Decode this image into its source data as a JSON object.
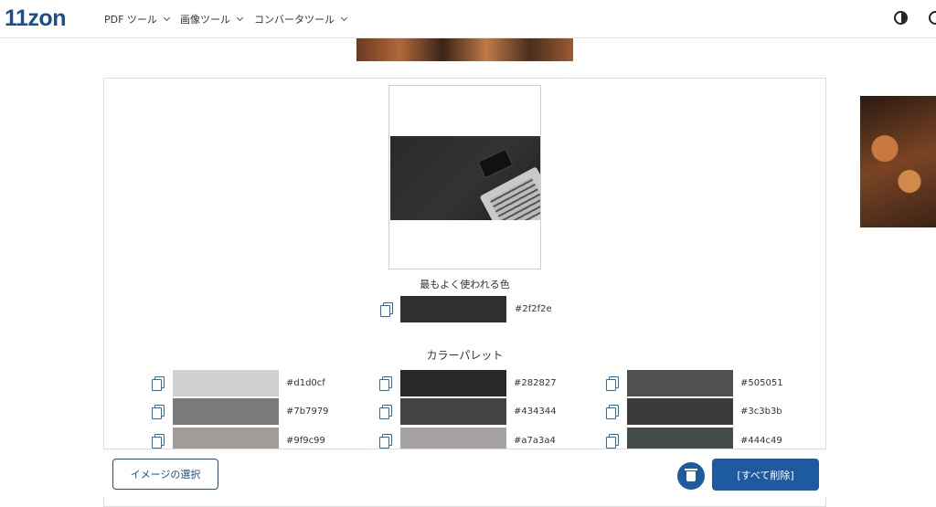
{
  "header": {
    "logo": "11zon",
    "nav": [
      "PDF ツール",
      "画像ツール",
      "コンバータツール"
    ]
  },
  "main": {
    "most_used_label": "最もよく使われる色",
    "most_used": {
      "hex": "#2f2f2e",
      "color": "#2f2f2e"
    },
    "palette_label": "カラーパレット",
    "palette": [
      {
        "hex": "#d1d0cf",
        "color": "#d1d0cf"
      },
      {
        "hex": "#282827",
        "color": "#282827"
      },
      {
        "hex": "#505051",
        "color": "#505051"
      },
      {
        "hex": "#7b7979",
        "color": "#7b7979"
      },
      {
        "hex": "#434344",
        "color": "#434344"
      },
      {
        "hex": "#3c3b3b",
        "color": "#3c3b3b"
      },
      {
        "hex": "#9f9c99",
        "color": "#9f9c99"
      },
      {
        "hex": "#a7a3a4",
        "color": "#a7a3a4"
      },
      {
        "hex": "#444c49",
        "color": "#444c49"
      }
    ]
  },
  "footer": {
    "select_label": "イメージの選択",
    "delete_label": "[すべて削除]"
  },
  "colors": {
    "brand": "#1e5aa0",
    "logo": "#1c4f8a"
  }
}
